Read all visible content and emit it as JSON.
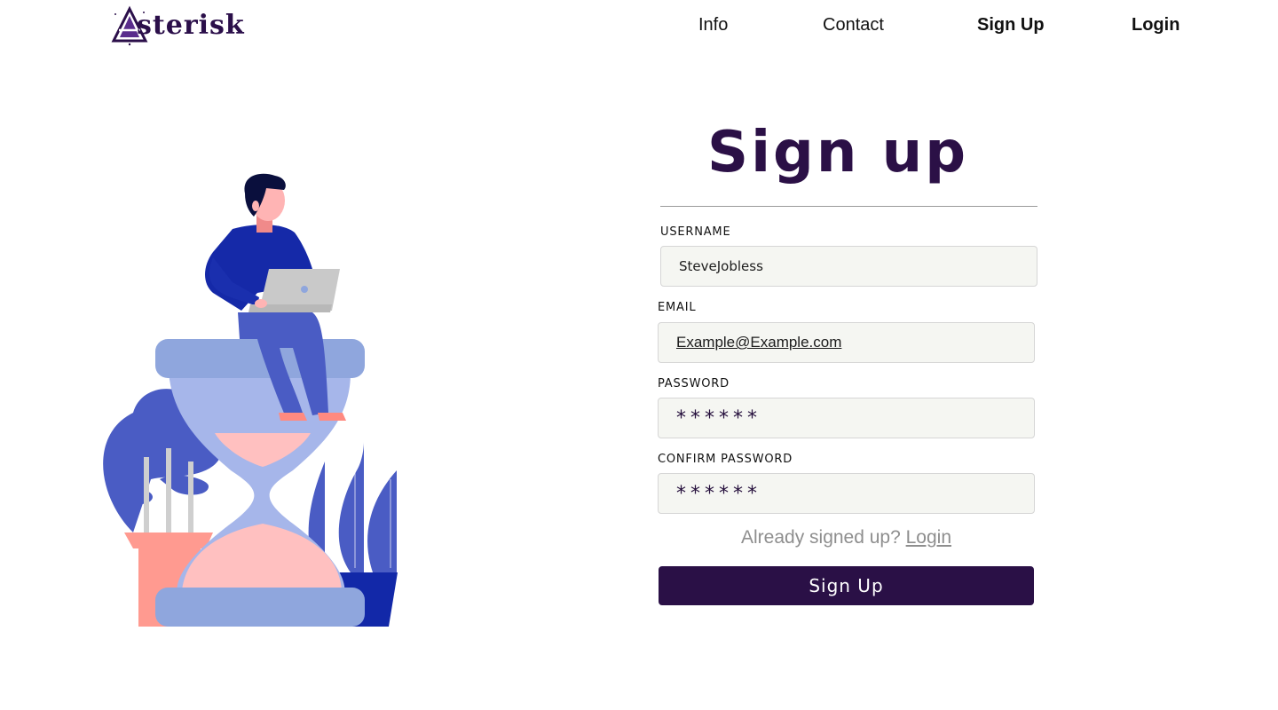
{
  "header": {
    "logo_text": "sterisk",
    "nav": {
      "info": "Info",
      "contact": "Contact",
      "signup": "Sign Up",
      "login": "Login"
    }
  },
  "form": {
    "title": "Sign up",
    "username": {
      "label": "USERNAME",
      "value": "SteveJobless"
    },
    "email": {
      "label": "EMAIL",
      "value": "Example@Example.com"
    },
    "password": {
      "label": "PASSWORD",
      "value": "******"
    },
    "confirm_password": {
      "label": "CONFIRM PASSWORD",
      "value": "******"
    },
    "already_text": "Already signed up?",
    "login_link": "Login",
    "submit_label": "Sign Up"
  },
  "colors": {
    "brand_dark_purple": "#2a1046",
    "field_background": "#f5f6f2",
    "muted_text": "#8e8e8e",
    "illustration_blue": "#4a5cc4",
    "illustration_pink": "#ffc0c0"
  },
  "illustration": {
    "icon": "person-on-hourglass-illustration"
  }
}
